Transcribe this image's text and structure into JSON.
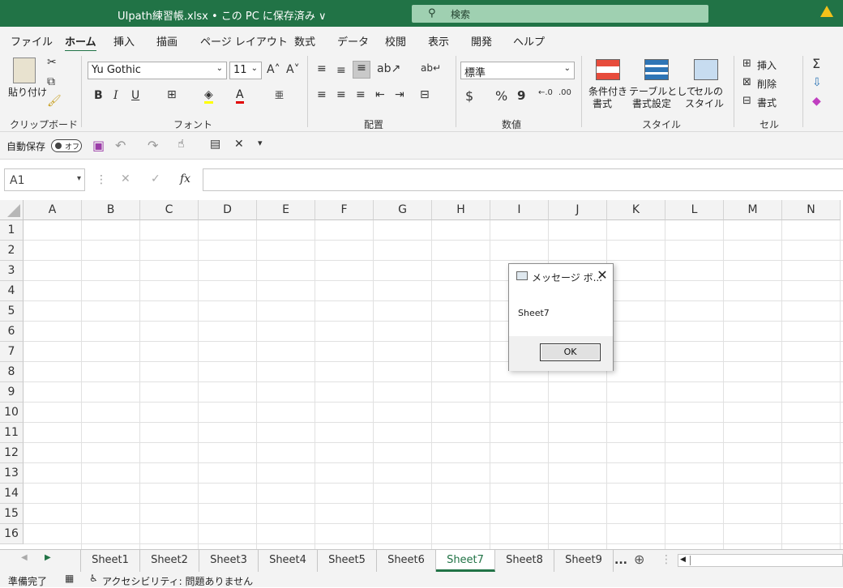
{
  "titlebar": {
    "title": "UIpath練習帳.xlsx • この PC に保存済み ∨",
    "search_placeholder": "検索",
    "search_icon": "search-icon",
    "warning_icon": "warning-icon"
  },
  "menu": {
    "items": [
      "ファイル",
      "ホーム",
      "挿入",
      "描画",
      "ページ レイアウト",
      "数式",
      "データ",
      "校閲",
      "表示",
      "開発",
      "ヘルプ"
    ],
    "active": "ホーム"
  },
  "ribbon": {
    "clipboard": {
      "paste": "貼り付け",
      "group": "クリップボード"
    },
    "font": {
      "name": "Yu Gothic",
      "size": "11",
      "bold": "B",
      "italic": "I",
      "underline": "U",
      "grow": "A^",
      "shrink": "Aˇ",
      "group": "フォント"
    },
    "alignment": {
      "group": "配置"
    },
    "number": {
      "format": "標準",
      "currency": "$",
      "percent": "%",
      "comma": "9",
      "group": "数値"
    },
    "styles": {
      "conditional_1": "条件付き",
      "conditional_2": "書式",
      "table_1": "テーブルとして",
      "table_2": "書式設定",
      "cell_1": "セルの",
      "cell_2": "スタイル",
      "group": "スタイル"
    },
    "cells": {
      "insert": "挿入",
      "delete": "削除",
      "format": "書式",
      "group": "セル"
    },
    "editing": {
      "sum": "Σ"
    }
  },
  "qat": {
    "autosave": "自動保存",
    "toggle": "オフ"
  },
  "formula_bar": {
    "name_box": "A1",
    "cancel": "✕",
    "enter": "✓",
    "fx": "fx",
    "value": ""
  },
  "grid": {
    "columns": [
      "A",
      "B",
      "C",
      "D",
      "E",
      "F",
      "G",
      "H",
      "I",
      "J",
      "K",
      "L",
      "M",
      "N"
    ],
    "rows": [
      "1",
      "2",
      "3",
      "4",
      "5",
      "6",
      "7",
      "8",
      "9",
      "10",
      "11",
      "12",
      "13",
      "14",
      "15",
      "16"
    ]
  },
  "sheet_tabs": {
    "tabs": [
      "Sheet1",
      "Sheet2",
      "Sheet3",
      "Sheet4",
      "Sheet5",
      "Sheet6",
      "Sheet7",
      "Sheet8",
      "Sheet9"
    ],
    "active": "Sheet7",
    "more": "...",
    "add": "⊕"
  },
  "statusbar": {
    "ready": "準備完了",
    "accessibility": "アクセシビリティ: 問題ありません"
  },
  "dialog": {
    "title": "メッセージ ボ...",
    "message": "Sheet7",
    "ok": "OK",
    "close": "✕"
  }
}
